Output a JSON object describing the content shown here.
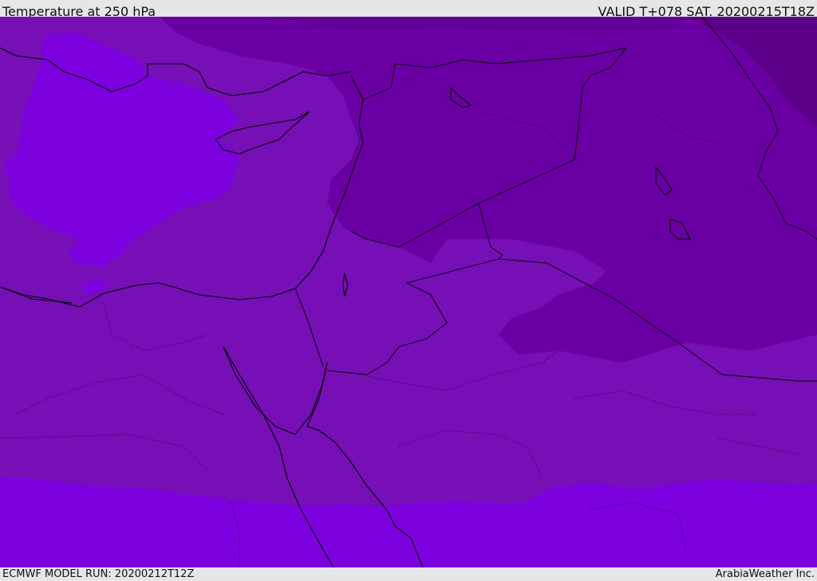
{
  "header": {
    "title": "Temperature at 250 hPa",
    "valid": "VALID T+078 SAT. 20200215T18Z"
  },
  "footer": {
    "run": "ECMWF MODEL RUN: 20200212T12Z",
    "credit": "ArabiaWeather Inc."
  },
  "colors": {
    "band_warmest": "#7d00de",
    "band_mid": "#760fb5",
    "band_cool": "#6900a0",
    "band_coldest": "#5a0088",
    "coastline": "#000000"
  }
}
